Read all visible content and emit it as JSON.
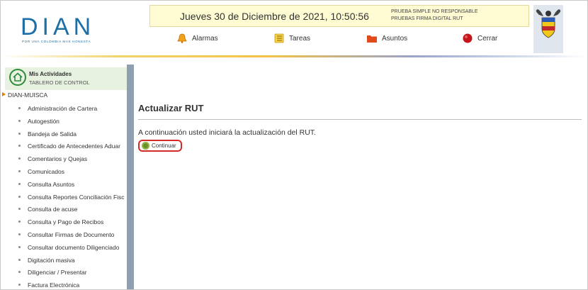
{
  "header": {
    "logo_text": "DIAN",
    "logo_tagline": "POR UNA COLOMBIA MAS HONESTA",
    "date": "Jueves 30 de Diciembre de 2021, 10:50:56",
    "notice_line1": "PRUEBA SIMPLE NO RESPONSABLE",
    "notice_line2": "PRUEBAS FIRMA DIGITAL RUT",
    "nav": {
      "alarmas": "Alarmas",
      "tareas": "Tareas",
      "asuntos": "Asuntos",
      "cerrar": "Cerrar"
    }
  },
  "sidebar": {
    "title": "Mis Actividades",
    "subtitle": "TABLERO DE CONTROL",
    "root": "DIAN-MUISCA",
    "items": [
      "Administración de Cartera",
      "Autogestión",
      "Bandeja de Salida",
      "Certificado de Antecedentes Aduar",
      "Comentarios y Quejas",
      "Comunicados",
      "Consulta Asuntos",
      "Consulta Reportes Conciliación Fisc",
      "Consulta de acuse",
      "Consulta y Pago de Recibos",
      "Consultar Firmas de Documento",
      "Consultar documento Diligenciado",
      "Digitación masiva",
      "Diligenciar / Presentar",
      "Factura Electrónica"
    ]
  },
  "main": {
    "title": "Actualizar RUT",
    "message": "A continuación usted iniciará la actualización del RUT.",
    "button": "Continuar"
  }
}
